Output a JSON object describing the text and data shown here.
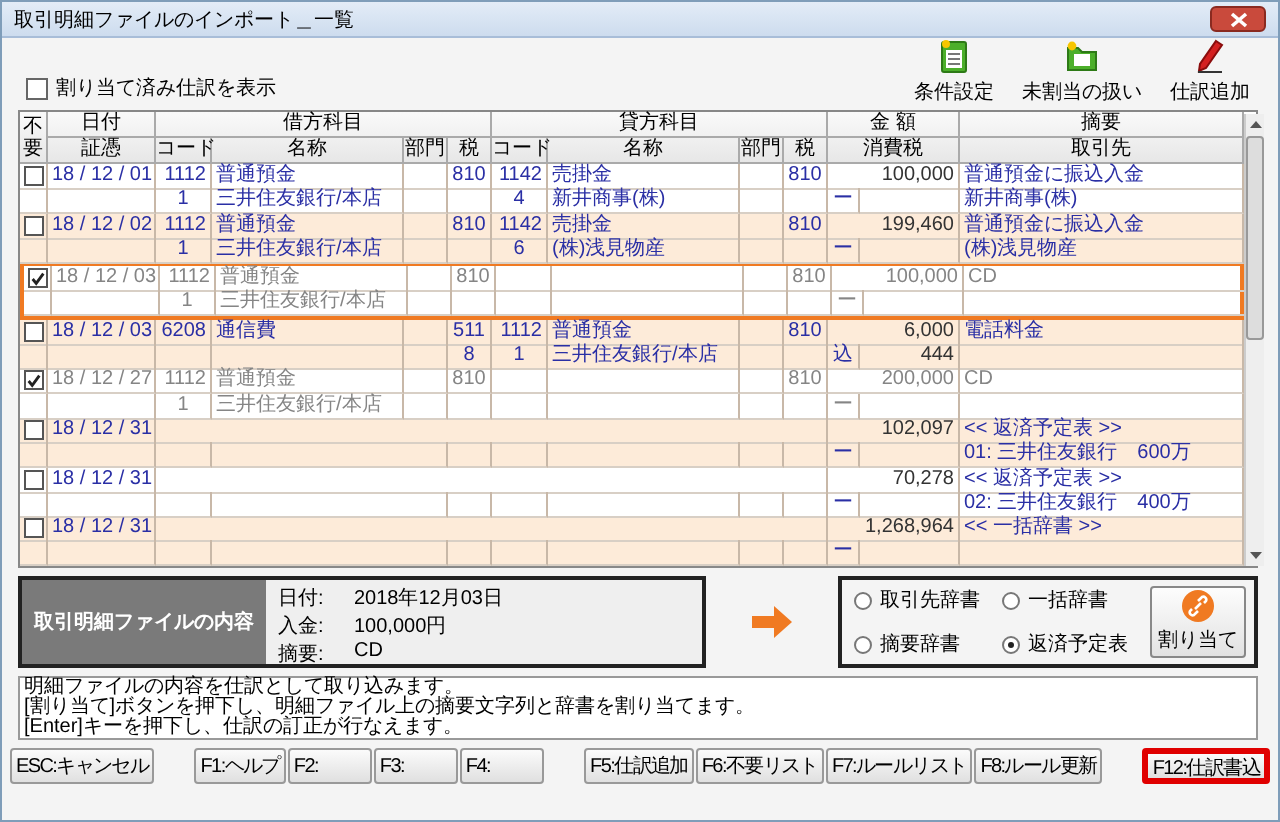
{
  "window": {
    "title": "取引明細ファイルのインポート＿一覧"
  },
  "show_assigned": {
    "label": "割り当て済み仕訳を表示",
    "checked": false
  },
  "toolbar": [
    {
      "label": "条件設定",
      "kind": "conditions"
    },
    {
      "label": "未割当の扱い",
      "kind": "folder"
    },
    {
      "label": "仕訳追加",
      "kind": "pencil"
    }
  ],
  "table": {
    "columns_top": [
      "不要",
      "日付",
      "借方科目",
      "貸方科目",
      "金 額",
      "摘要"
    ],
    "columns_bottom": [
      "証憑",
      "コード",
      "名称",
      "部門",
      "税",
      "コード",
      "名称",
      "部門",
      "税",
      "消費税",
      "取引先"
    ],
    "rows": [
      {
        "kind": "entry",
        "unneeded": false,
        "selected": false,
        "date": "18 / 12 / 01",
        "debit": {
          "code": "1112",
          "name": "普通預金",
          "tax": "810",
          "sub_code": "1",
          "sub_name": "三井住友銀行/本店"
        },
        "credit": {
          "code": "1142",
          "name": "売掛金",
          "tax": "810",
          "sub_code": "4",
          "sub_name": "新井商事(株)"
        },
        "amount": "100,000",
        "memo": "普通預金に振込入金",
        "tax_mark": "ー",
        "partner": "新井商事(株)"
      },
      {
        "kind": "entry",
        "unneeded": false,
        "selected": false,
        "date": "18 / 12 / 02",
        "debit": {
          "code": "1112",
          "name": "普通預金",
          "tax": "810",
          "sub_code": "1",
          "sub_name": "三井住友銀行/本店"
        },
        "credit": {
          "code": "1142",
          "name": "売掛金",
          "tax": "810",
          "sub_code": "6",
          "sub_name": "(株)浅見物産"
        },
        "amount": "199,460",
        "memo": "普通預金に振込入金",
        "tax_mark": "ー",
        "partner": "(株)浅見物産"
      },
      {
        "kind": "entry",
        "unneeded": true,
        "selected": true,
        "date": "18 / 12 / 03",
        "debit": {
          "code": "1112",
          "name": "普通預金",
          "tax": "810",
          "sub_code": "1",
          "sub_name": "三井住友銀行/本店"
        },
        "credit": {
          "tax": "810"
        },
        "amount": "100,000",
        "memo": "CD",
        "tax_mark": "ー"
      },
      {
        "kind": "entry",
        "unneeded": false,
        "selected": false,
        "date": "18 / 12 / 03",
        "debit": {
          "code": "6208",
          "name": "通信費",
          "tax": "511",
          "rate": "8"
        },
        "credit": {
          "code": "1112",
          "name": "普通預金",
          "tax": "810",
          "sub_code": "1",
          "sub_name": "三井住友銀行/本店"
        },
        "amount": "6,000",
        "memo": "電話料金",
        "tax_mark": "込",
        "tax_amount": "444"
      },
      {
        "kind": "entry",
        "unneeded": true,
        "selected": false,
        "date": "18 / 12 / 27",
        "debit": {
          "code": "1112",
          "name": "普通預金",
          "tax": "810",
          "sub_code": "1",
          "sub_name": "三井住友銀行/本店"
        },
        "credit": {
          "tax": "810"
        },
        "amount": "200,000",
        "memo": "CD",
        "tax_mark": "ー"
      },
      {
        "kind": "summary",
        "unneeded": false,
        "selected": false,
        "date": "18 / 12 / 31",
        "amount": "102,097",
        "memo": "<< 返済予定表 >>",
        "tax_mark": "ー",
        "partner": "01: 三井住友銀行　600万"
      },
      {
        "kind": "summary",
        "unneeded": false,
        "selected": false,
        "date": "18 / 12 / 31",
        "amount": "70,278",
        "memo": "<< 返済予定表 >>",
        "tax_mark": "ー",
        "partner": "02: 三井住友銀行　400万"
      },
      {
        "kind": "summary",
        "unneeded": false,
        "selected": false,
        "date": "18 / 12 / 31",
        "amount": "1,268,964",
        "memo": "<< 一括辞書 >>",
        "tax_mark": "ー"
      }
    ]
  },
  "detail": {
    "heading": "取引明細ファイルの内容",
    "fields": [
      {
        "label": "日付:",
        "value": "2018年12月03日"
      },
      {
        "label": "入金:",
        "value": "100,000円"
      },
      {
        "label": "摘要:",
        "value": "CD"
      }
    ]
  },
  "assign": {
    "options": [
      {
        "label": "取引先辞書",
        "selected": false
      },
      {
        "label": "一括辞書",
        "selected": false
      },
      {
        "label": "摘要辞書",
        "selected": false
      },
      {
        "label": "返済予定表",
        "selected": true
      }
    ],
    "button": "割り当て"
  },
  "messages": [
    "明細ファイルの内容を仕訳として取り込みます。",
    "[割り当て]ボタンを押下し、明細ファイル上の摘要文字列と辞書を割り当てます。",
    "[Enter]キーを押下し、仕訳の訂正が行なえます。"
  ],
  "function_keys": [
    [
      {
        "label": "ESC:キャンセル",
        "highlighted": false
      }
    ],
    [
      {
        "label": "F1:ヘルプ",
        "highlighted": false
      },
      {
        "label": "F2:",
        "highlighted": false
      },
      {
        "label": "F3:",
        "highlighted": false
      },
      {
        "label": "F4:",
        "highlighted": false
      }
    ],
    [
      {
        "label": "F5:仕訳追加",
        "highlighted": false
      },
      {
        "label": "F6:不要リスト",
        "highlighted": false
      },
      {
        "label": "F7:ルールリスト",
        "highlighted": false
      },
      {
        "label": "F8:ルール更新",
        "highlighted": false
      }
    ],
    [
      {
        "label": "F12:仕訳書込",
        "highlighted": true
      }
    ]
  ]
}
